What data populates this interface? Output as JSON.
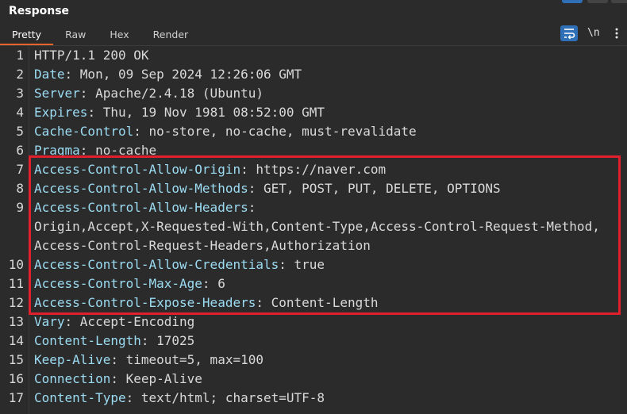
{
  "panel": {
    "title": "Response"
  },
  "tabs": [
    {
      "label": "Pretty",
      "active": true
    },
    {
      "label": "Raw",
      "active": false
    },
    {
      "label": "Hex",
      "active": false
    },
    {
      "label": "Render",
      "active": false
    }
  ],
  "toolbar": {
    "wrap_icon": "word-wrap-icon",
    "newline_label": "\\n",
    "menu_icon": "more-vertical-icon"
  },
  "lines": [
    {
      "n": "1",
      "key": "HTTP/1.1 200 OK",
      "sep": "",
      "val": ""
    },
    {
      "n": "2",
      "key": "Date",
      "sep": ": ",
      "val": "Mon, 09 Sep 2024 12:26:06 GMT"
    },
    {
      "n": "3",
      "key": "Server",
      "sep": ": ",
      "val": "Apache/2.4.18 (Ubuntu)"
    },
    {
      "n": "4",
      "key": "Expires",
      "sep": ": ",
      "val": "Thu, 19 Nov 1981 08:52:00 GMT"
    },
    {
      "n": "5",
      "key": "Cache-Control",
      "sep": ": ",
      "val": "no-store, no-cache, must-revalidate"
    },
    {
      "n": "6",
      "key": "Pragma",
      "sep": ": ",
      "val": "no-cache"
    },
    {
      "n": "7",
      "key": "Access-Control-Allow-Origin",
      "sep": ": ",
      "val": "https://naver.com"
    },
    {
      "n": "8",
      "key": "Access-Control-Allow-Methods",
      "sep": ": ",
      "val": "GET, POST, PUT, DELETE, OPTIONS"
    },
    {
      "n": "9",
      "key": "Access-Control-Allow-Headers",
      "sep": ":",
      "val": ""
    },
    {
      "n": "",
      "key": "",
      "sep": "",
      "val": "Origin,Accept,X-Requested-With,Content-Type,Access-Control-Request-Method,"
    },
    {
      "n": "",
      "key": "",
      "sep": "",
      "val": "Access-Control-Request-Headers,Authorization"
    },
    {
      "n": "10",
      "key": "Access-Control-Allow-Credentials",
      "sep": ": ",
      "val": "true"
    },
    {
      "n": "11",
      "key": "Access-Control-Max-Age",
      "sep": ": ",
      "val": "6"
    },
    {
      "n": "12",
      "key": "Access-Control-Expose-Headers",
      "sep": ": ",
      "val": "Content-Length"
    },
    {
      "n": "13",
      "key": "Vary",
      "sep": ": ",
      "val": "Accept-Encoding"
    },
    {
      "n": "14",
      "key": "Content-Length",
      "sep": ": ",
      "val": "17025"
    },
    {
      "n": "15",
      "key": "Keep-Alive",
      "sep": ": ",
      "val": "timeout=5, max=100"
    },
    {
      "n": "16",
      "key": "Connection",
      "sep": ": ",
      "val": "Keep-Alive"
    },
    {
      "n": "17",
      "key": "Content-Type",
      "sep": ": ",
      "val": "text/html; charset=UTF-8"
    }
  ],
  "colors": {
    "background": "#2b2b2b",
    "header_key": "#9cdcf3",
    "header_value": "#d9d9d9",
    "active_tab_underline": "#e8622a",
    "highlight_border": "#e0202c",
    "wrap_button": "#2e6fb7"
  }
}
